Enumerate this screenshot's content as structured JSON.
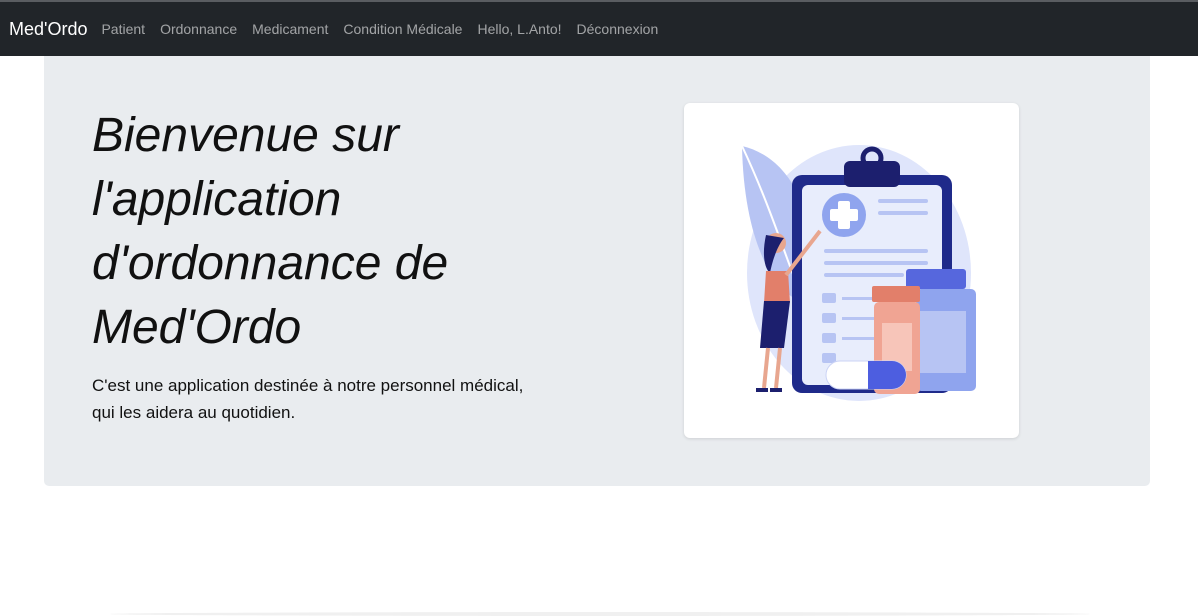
{
  "navbar": {
    "brand": "Med'Ordo",
    "links": [
      {
        "label": "Patient"
      },
      {
        "label": "Ordonnance"
      },
      {
        "label": "Medicament"
      },
      {
        "label": "Condition Médicale"
      }
    ],
    "greeting": "Hello, L.Anto!",
    "logout": "Déconnexion",
    "background_color": "#212529"
  },
  "hero": {
    "title": "Bienvenue sur l'application d'ordonnance de Med'Ordo",
    "lead_line1": "C'est une application destinée à notre personnel médical,",
    "lead_line2": "qui les aidera au quotidien.",
    "background_color": "#e9ecef"
  },
  "illustration": {
    "icon": "doctor-clipboard-medicine-illustration",
    "colors": {
      "blue_dark": "#1f2a8a",
      "blue_light": "#8fa4ee",
      "blue_pale": "#dfe5fb",
      "salmon": "#e27f6a",
      "navy": "#1c1f6e"
    }
  }
}
